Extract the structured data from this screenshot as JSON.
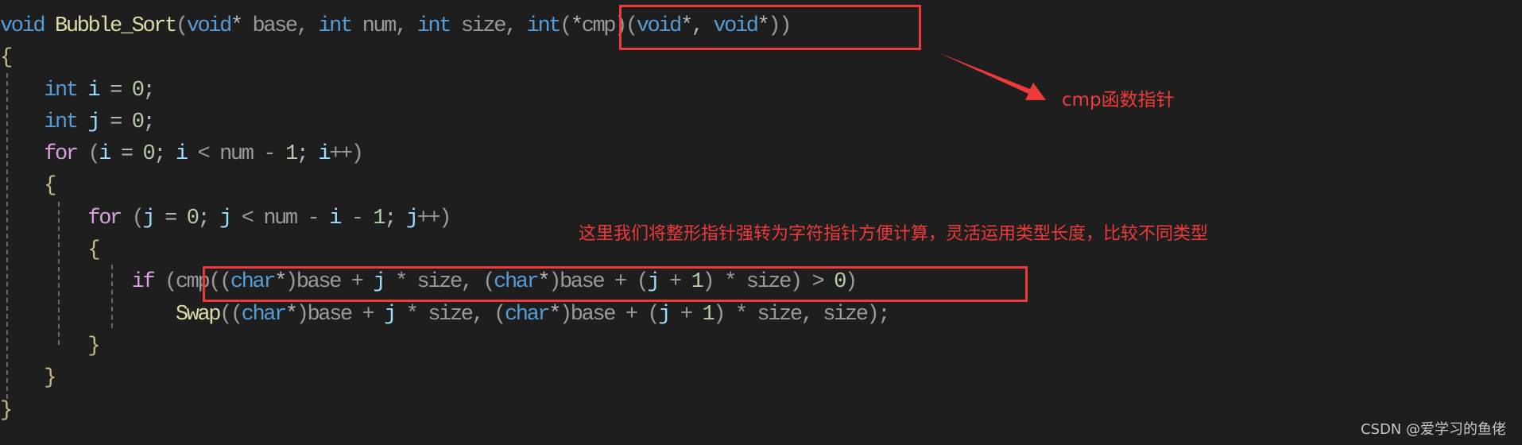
{
  "code": {
    "lines": [
      [
        {
          "t": "void",
          "c": "kw"
        },
        {
          "t": " ",
          "c": "pn"
        },
        {
          "t": "Bubble_Sort",
          "c": "fn"
        },
        {
          "t": "(",
          "c": "pn"
        },
        {
          "t": "void",
          "c": "kw"
        },
        {
          "t": "* ",
          "c": "op"
        },
        {
          "t": "base, ",
          "c": "pn"
        },
        {
          "t": "int",
          "c": "kw"
        },
        {
          "t": " num, ",
          "c": "pn"
        },
        {
          "t": "int",
          "c": "kw"
        },
        {
          "t": " size, ",
          "c": "pn"
        },
        {
          "t": "int",
          "c": "kw"
        },
        {
          "t": "(",
          "c": "pn"
        },
        {
          "t": "*",
          "c": "op"
        },
        {
          "t": "cmp",
          "c": "pn"
        },
        {
          "t": ")(",
          "c": "pn"
        },
        {
          "t": "void",
          "c": "kw"
        },
        {
          "t": "*, ",
          "c": "op"
        },
        {
          "t": "void",
          "c": "kw"
        },
        {
          "t": "*",
          "c": "op"
        },
        {
          "t": "))",
          "c": "pn"
        }
      ],
      [
        {
          "t": "{",
          "c": "br"
        }
      ],
      [
        {
          "t": "    ",
          "c": "pn"
        },
        {
          "t": "int",
          "c": "kw"
        },
        {
          "t": " ",
          "c": "pn"
        },
        {
          "t": "i",
          "c": "var"
        },
        {
          "t": " = ",
          "c": "op"
        },
        {
          "t": "0",
          "c": "num"
        },
        {
          "t": ";",
          "c": "op"
        }
      ],
      [
        {
          "t": "    ",
          "c": "pn"
        },
        {
          "t": "int",
          "c": "kw"
        },
        {
          "t": " ",
          "c": "pn"
        },
        {
          "t": "j",
          "c": "var"
        },
        {
          "t": " = ",
          "c": "op"
        },
        {
          "t": "0",
          "c": "num"
        },
        {
          "t": ";",
          "c": "op"
        }
      ],
      [
        {
          "t": "    ",
          "c": "pn"
        },
        {
          "t": "for",
          "c": "ctl"
        },
        {
          "t": " (",
          "c": "pn"
        },
        {
          "t": "i",
          "c": "var"
        },
        {
          "t": " = ",
          "c": "op"
        },
        {
          "t": "0",
          "c": "num"
        },
        {
          "t": "; ",
          "c": "op"
        },
        {
          "t": "i",
          "c": "var"
        },
        {
          "t": " < num - ",
          "c": "pn"
        },
        {
          "t": "1",
          "c": "num"
        },
        {
          "t": "; ",
          "c": "op"
        },
        {
          "t": "i",
          "c": "var"
        },
        {
          "t": "++)",
          "c": "pn"
        }
      ],
      [
        {
          "t": "    ",
          "c": "pn"
        },
        {
          "t": "{",
          "c": "br"
        }
      ],
      [
        {
          "t": "        ",
          "c": "pn"
        },
        {
          "t": "for",
          "c": "ctl"
        },
        {
          "t": " (",
          "c": "pn"
        },
        {
          "t": "j",
          "c": "var"
        },
        {
          "t": " = ",
          "c": "op"
        },
        {
          "t": "0",
          "c": "num"
        },
        {
          "t": "; ",
          "c": "op"
        },
        {
          "t": "j",
          "c": "var"
        },
        {
          "t": " < num - ",
          "c": "pn"
        },
        {
          "t": "i",
          "c": "var"
        },
        {
          "t": " - ",
          "c": "pn"
        },
        {
          "t": "1",
          "c": "num"
        },
        {
          "t": "; ",
          "c": "op"
        },
        {
          "t": "j",
          "c": "var"
        },
        {
          "t": "++)",
          "c": "pn"
        }
      ],
      [
        {
          "t": "        ",
          "c": "pn"
        },
        {
          "t": "{",
          "c": "br"
        }
      ],
      [
        {
          "t": "            ",
          "c": "pn"
        },
        {
          "t": "if",
          "c": "ctl"
        },
        {
          "t": " (cmp((",
          "c": "pn"
        },
        {
          "t": "char",
          "c": "kw"
        },
        {
          "t": "*",
          "c": "op"
        },
        {
          "t": ")base + ",
          "c": "pn"
        },
        {
          "t": "j",
          "c": "var"
        },
        {
          "t": " * size, (",
          "c": "pn"
        },
        {
          "t": "char",
          "c": "kw"
        },
        {
          "t": "*",
          "c": "op"
        },
        {
          "t": ")base + (",
          "c": "pn"
        },
        {
          "t": "j",
          "c": "var"
        },
        {
          "t": " + ",
          "c": "pn"
        },
        {
          "t": "1",
          "c": "num"
        },
        {
          "t": ") * size) > ",
          "c": "pn"
        },
        {
          "t": "0",
          "c": "num"
        },
        {
          "t": ")",
          "c": "pn"
        }
      ],
      [
        {
          "t": "                ",
          "c": "pn"
        },
        {
          "t": "Swap",
          "c": "fn"
        },
        {
          "t": "((",
          "c": "pn"
        },
        {
          "t": "char",
          "c": "kw"
        },
        {
          "t": "*",
          "c": "op"
        },
        {
          "t": ")base + ",
          "c": "pn"
        },
        {
          "t": "j",
          "c": "var"
        },
        {
          "t": " * size, (",
          "c": "pn"
        },
        {
          "t": "char",
          "c": "kw"
        },
        {
          "t": "*",
          "c": "op"
        },
        {
          "t": ")base + (",
          "c": "pn"
        },
        {
          "t": "j",
          "c": "var"
        },
        {
          "t": " + ",
          "c": "pn"
        },
        {
          "t": "1",
          "c": "num"
        },
        {
          "t": ") * size, size);",
          "c": "pn"
        }
      ],
      [
        {
          "t": "        ",
          "c": "pn"
        },
        {
          "t": "}",
          "c": "br"
        }
      ],
      [
        {
          "t": "    ",
          "c": "pn"
        },
        {
          "t": "}",
          "c": "br"
        }
      ],
      [
        {
          "t": "}",
          "c": "br"
        }
      ]
    ]
  },
  "annotations": {
    "cmp_note": "cmp函数指针",
    "cast_note": "这里我们将整形指针强转为字符指针方便计算，灵活运用类型长度，比较不同类型"
  },
  "colors": {
    "annotation": "#ef3a3a",
    "background": "#1e1e1e"
  },
  "watermark": "CSDN @爱学习的鱼佬"
}
